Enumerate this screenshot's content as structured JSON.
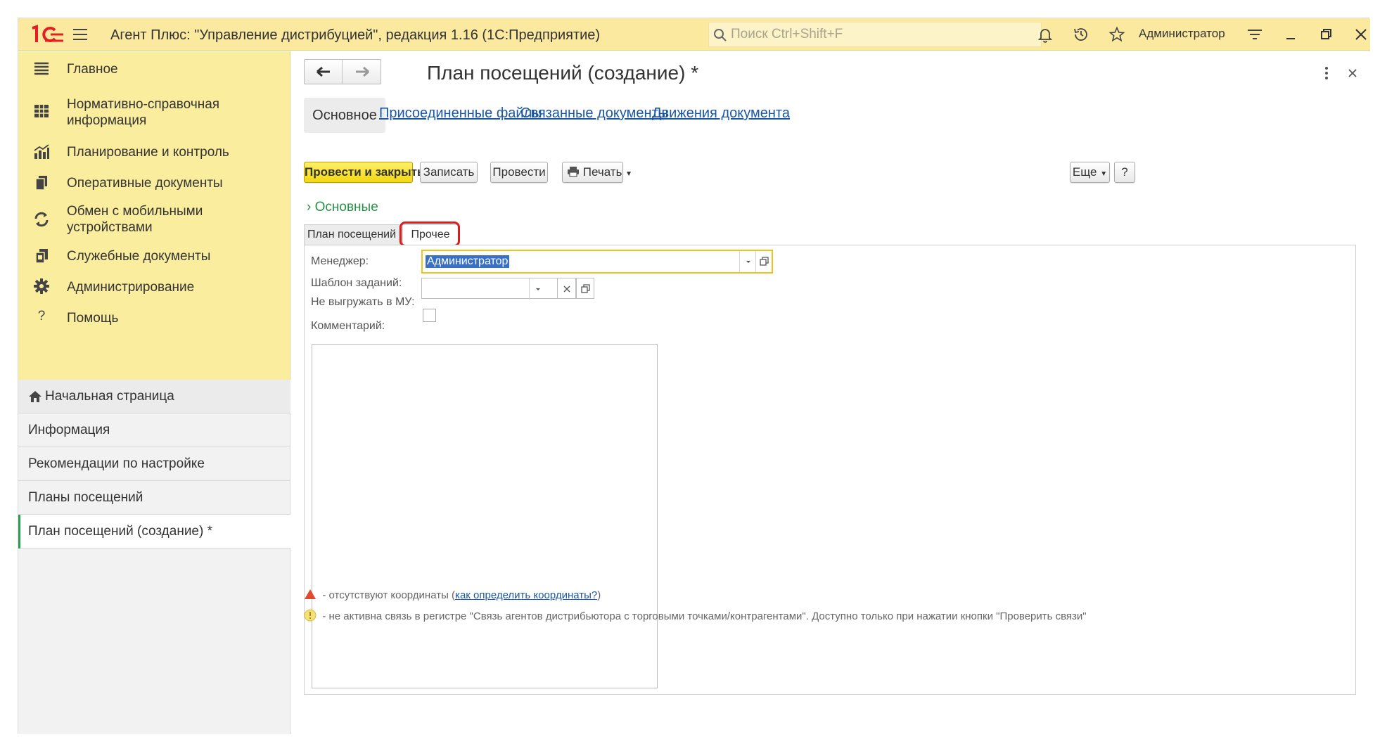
{
  "app": {
    "title": "Агент Плюс: \"Управление дистрибуцией\", редакция 1.16  (1С:Предприятие)",
    "search_placeholder": "Поиск Ctrl+Shift+F",
    "user": "Администратор",
    "brand_color": "#e31e24",
    "titlebar_color": "#fbe9a0"
  },
  "sidebar": {
    "items": [
      {
        "label": "Главное",
        "icon": "hamburger-list-icon"
      },
      {
        "label": "Нормативно-справочная информация",
        "icon": "grid-icon"
      },
      {
        "label": "Планирование и контроль",
        "icon": "bar-chart-icon"
      },
      {
        "label": "Оперативные документы",
        "icon": "documents-icon"
      },
      {
        "label": "Обмен с мобильными устройствами",
        "icon": "sync-icon"
      },
      {
        "label": "Служебные документы",
        "icon": "service-docs-icon"
      },
      {
        "label": "Администрирование",
        "icon": "gear-icon"
      },
      {
        "label": "Помощь",
        "icon": "question-icon"
      }
    ],
    "open_windows": [
      {
        "label": "Начальная страница",
        "icon": "home-icon"
      },
      {
        "label": "Информация"
      },
      {
        "label": "Рекомендации по настройке"
      },
      {
        "label": "Планы посещений"
      },
      {
        "label": "План посещений  (создание) *",
        "active": true
      }
    ]
  },
  "document": {
    "title": "План посещений  (создание) *",
    "tabs": {
      "main": "Основное",
      "files": "Присоединенные файлы",
      "related": "Связанные документы",
      "movements": "Движения документа"
    },
    "toolbar": {
      "post_close": "Провести и закрыть",
      "save": "Записать",
      "post": "Провести",
      "print": "Печать",
      "more": "Еще",
      "help": "?"
    },
    "section_label": "Основные",
    "inner_tabs": {
      "plan": "План посещений",
      "other": "Прочее"
    },
    "fields": {
      "manager_label": "Менеджер:",
      "manager_value": "Администратор",
      "template_label": "Шаблон заданий:",
      "template_value": "",
      "no_upload_label": "Не выгружать в МУ:",
      "no_upload_checked": false,
      "comment_label": "Комментарий:",
      "comment_value": ""
    },
    "legend": {
      "no_coords_text": "- отсутствуют координаты (",
      "no_coords_link": "как определить координаты?",
      "no_coords_close": ")",
      "inactive_link_text": "- не активна связь в регистре \"Связь агентов дистрибьютора с торговыми точками/контрагентами\". Доступно только при нажатии кнопки \"Проверить связи\""
    }
  }
}
